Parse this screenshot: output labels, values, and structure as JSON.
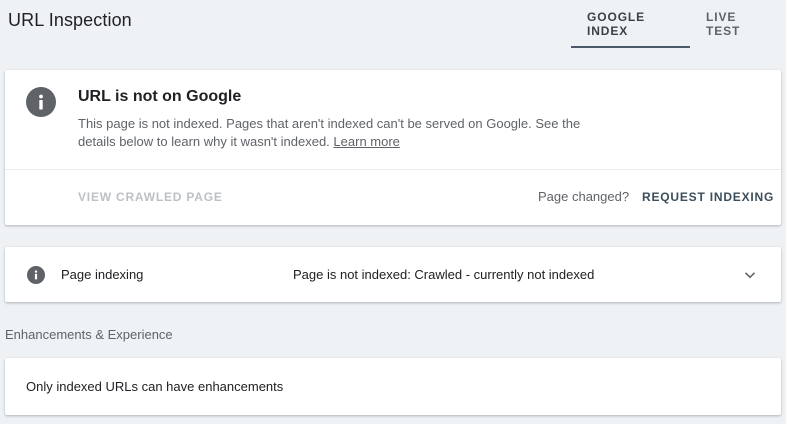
{
  "header": {
    "title": "URL Inspection",
    "tabs": [
      {
        "label": "GOOGLE INDEX",
        "active": true
      },
      {
        "label": "LIVE TEST",
        "active": false
      }
    ]
  },
  "status_card": {
    "icon": "info-icon",
    "heading": "URL is not on Google",
    "description": "This page is not indexed. Pages that aren't indexed can't be served on Google. See the details below to learn why it wasn't indexed.",
    "learn_more": "Learn more",
    "view_crawled_label": "VIEW CRAWLED PAGE",
    "page_changed": "Page changed?",
    "request_indexing_label": "REQUEST INDEXING"
  },
  "indexing_card": {
    "icon": "info-icon",
    "label": "Page indexing",
    "value": "Page is not indexed: Crawled - currently not indexed",
    "expand_icon": "chevron-down-icon"
  },
  "enhancements": {
    "section_label": "Enhancements & Experience",
    "message": "Only indexed URLs can have enhancements"
  },
  "colors": {
    "background": "#eff2f5",
    "card": "#ffffff",
    "icon_gray": "#5f6368",
    "tab_indicator": "#4a5a68",
    "disabled_text": "#bdc1c6"
  }
}
